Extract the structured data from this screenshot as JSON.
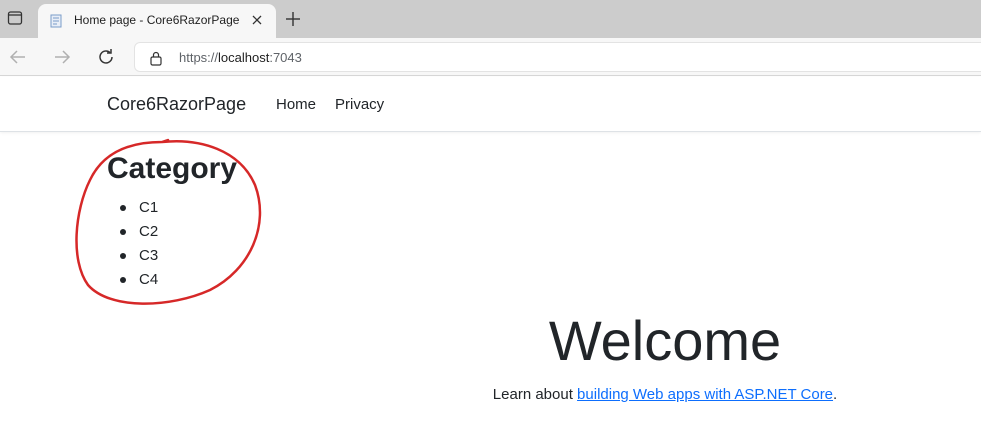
{
  "browser": {
    "tab_title": "Home page - Core6RazorPage",
    "url_scheme": "https://",
    "url_host": "localhost",
    "url_port": ":7043"
  },
  "navbar": {
    "brand": "Core6RazorPage",
    "links": [
      "Home",
      "Privacy"
    ]
  },
  "category": {
    "title": "Category",
    "items": [
      "C1",
      "C2",
      "C3",
      "C4"
    ]
  },
  "welcome": {
    "heading": "Welcome",
    "text_before": "Learn about ",
    "link_text": "building Web apps with ASP.NET Core",
    "text_after": "."
  },
  "colors": {
    "link": "#0d6efd",
    "annotation": "#d62828"
  }
}
